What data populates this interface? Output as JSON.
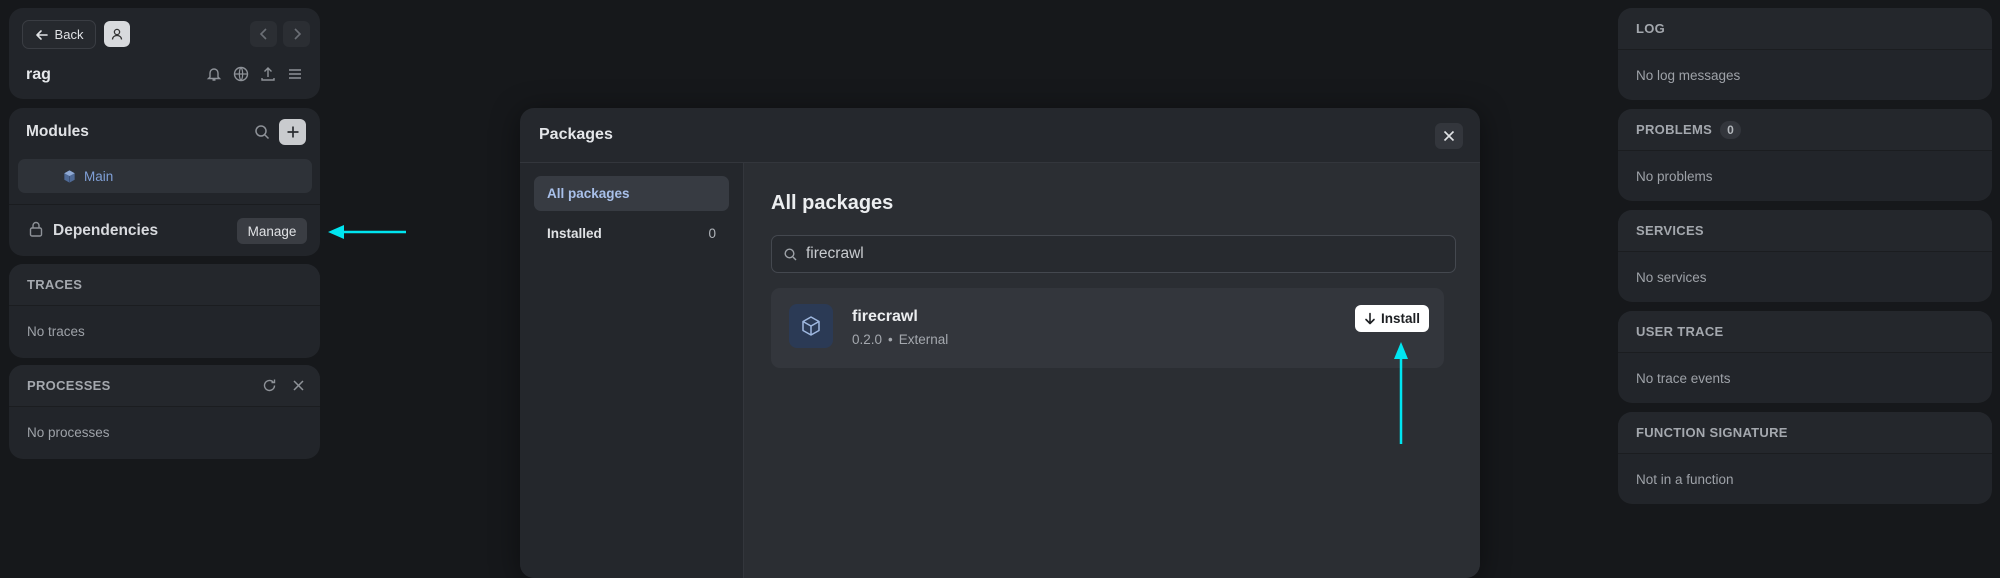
{
  "nav": {
    "back_label": "Back",
    "project_name": "rag"
  },
  "modules": {
    "title": "Modules",
    "items": [
      {
        "label": "Main"
      }
    ],
    "dependencies_label": "Dependencies",
    "manage_label": "Manage"
  },
  "traces": {
    "title": "TRACES",
    "empty": "No traces"
  },
  "processes": {
    "title": "PROCESSES",
    "empty": "No processes"
  },
  "right": {
    "log": {
      "title": "LOG",
      "empty": "No log messages"
    },
    "problems": {
      "title": "PROBLEMS",
      "count": "0",
      "empty": "No problems"
    },
    "services": {
      "title": "SERVICES",
      "empty": "No services"
    },
    "user_trace": {
      "title": "USER TRACE",
      "empty": "No trace events"
    },
    "function_signature": {
      "title": "FUNCTION SIGNATURE",
      "empty": "Not in a function"
    }
  },
  "modal": {
    "title": "Packages",
    "sidebar": [
      {
        "label": "All packages",
        "count": ""
      },
      {
        "label": "Installed",
        "count": "0"
      }
    ],
    "heading": "All packages",
    "search_value": "firecrawl",
    "results": [
      {
        "name": "firecrawl",
        "version": "0.2.0",
        "separator": "•",
        "source": "External",
        "action": "Install"
      }
    ]
  },
  "colors": {
    "accent": "#00e5f0",
    "background": "#16181b",
    "panel": "#22252a",
    "module_link": "#7f9fd6"
  },
  "icons": [
    "arrow-left-icon",
    "user-icon",
    "chevron-left-icon",
    "chevron-right-icon",
    "bell-icon",
    "globe-icon",
    "upload-icon",
    "menu-icon",
    "search-icon",
    "plus-icon",
    "cube-icon",
    "lock-icon",
    "refresh-icon",
    "close-icon",
    "download-icon"
  ]
}
